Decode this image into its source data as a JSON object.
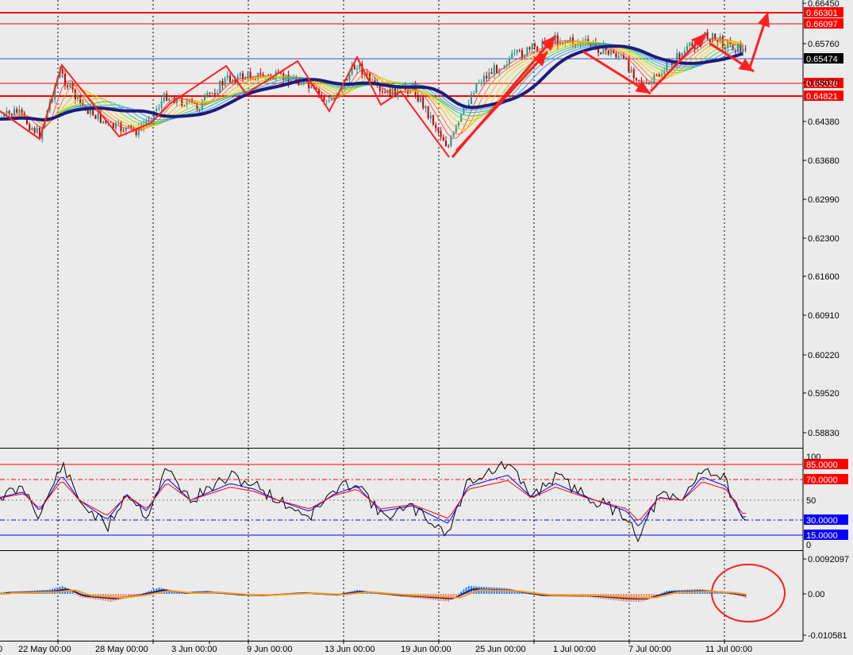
{
  "chart_data": {
    "type": "candlestick",
    "price_panel": {
      "y_ticks": [
        "0.66450",
        "0.65760",
        "0.65070",
        "0.64380",
        "0.63680",
        "0.62990",
        "0.62300",
        "0.61600",
        "0.60910",
        "0.60220",
        "0.59520",
        "0.58830"
      ],
      "y_range": [
        0.5865,
        0.6648
      ],
      "current_price": "0.65474",
      "levels": [
        {
          "label": "0.66301",
          "value": 0.66301,
          "color": "#ff0000",
          "thick": true
        },
        {
          "label": "0.66097",
          "value": 0.66097,
          "color": "#ff0000",
          "thick": false
        },
        {
          "label": "0.65036",
          "value": 0.65036,
          "color": "#ff0000",
          "thick": false
        },
        {
          "label": "0.64821",
          "value": 0.64821,
          "color": "#ff0000",
          "thick": true
        }
      ],
      "zigzag": [
        [
          0.6436,
          0.641,
          0.653,
          0.641,
          0.654,
          0.652,
          0.653,
          0.646,
          0.654,
          0.648,
          0.6372,
          0.659,
          0.654,
          0.648,
          0.659,
          0.656
        ]
      ]
    },
    "oscillator_panel": {
      "y_ticks": [
        "100",
        "50",
        "0"
      ],
      "levels": [
        {
          "label": "85.0000",
          "value": 85,
          "color": "#ff0000"
        },
        {
          "label": "70.0000",
          "value": 70,
          "color": "#ff0000"
        },
        {
          "label": "30.0000",
          "value": 30,
          "color": "#0000ff"
        },
        {
          "label": "15.0000",
          "value": 15,
          "color": "#0000ff"
        }
      ]
    },
    "macd_panel": {
      "y_ticks": [
        "0.0092097",
        "0.00",
        "-0.010581"
      ]
    },
    "x_ticks": [
      "22 May 00:00",
      "28 May 00:00",
      "3 Jun 00:00",
      "9 Jun 00:00",
      "13 Jun 00:00",
      "19 Jun 00:00",
      "25 Jun 00:00",
      "1 Jul 00:00",
      "7 Jul 00:00",
      "11 Jul 00:00"
    ],
    "x_tick_left_cut": "0"
  },
  "colors": {
    "background": "#ebebeb",
    "bull_candle": "#1f9a8a",
    "bear_candle": "#c00000",
    "ma_thick": "#1c1c7a",
    "annotation": "#ff2020",
    "current_tag": "#000000",
    "red_tag": "#ff0000",
    "blue_tag": "#0000ff"
  }
}
